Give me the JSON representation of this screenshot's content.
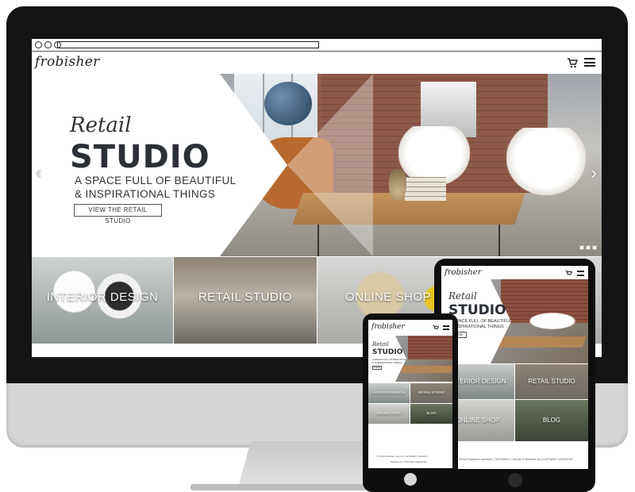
{
  "site": {
    "logo": "frobisher",
    "hero": {
      "script": "Retail",
      "title": "STUDIO",
      "tagline_line1": "A SPACE FULL OF BEAUTIFUL",
      "tagline_line2": "& INSPIRATIONAL THINGS",
      "button": "VIEW THE RETAIL STUDIO",
      "prev_arrow": "‹",
      "next_arrow": "›"
    },
    "tiles": [
      {
        "label": "INTERIOR DESIGN"
      },
      {
        "label": "RETAIL STUDIO"
      },
      {
        "label": "ONLINE SHOP"
      }
    ],
    "tablet_tiles": [
      {
        "label": "INTERIOR DESIGN"
      },
      {
        "label": "RETAIL STUDIO"
      },
      {
        "label": "ONLINE SHOP"
      },
      {
        "label": "BLOG"
      }
    ],
    "phone_tiles": [
      {
        "label": "INTERIOR DESIGN"
      },
      {
        "label": "RETAIL STUDIO"
      },
      {
        "label": "ONLINE SHOP"
      },
      {
        "label": "BLOG"
      }
    ],
    "tablet_button": "VIEW",
    "phone_button": "VIEW",
    "footer": "© 2016 Frobisher Interiors  |  SITEMAP  |  LEGALS",
    "footer_credit": "Website by CUSTARD CREATIVE"
  },
  "colors": {
    "bezel": "#141414",
    "aluminium": "#d6d6d8",
    "text_dark": "#2b2f36"
  },
  "icons": {
    "cart": "shopping-cart-icon",
    "menu": "hamburger-menu-icon"
  }
}
